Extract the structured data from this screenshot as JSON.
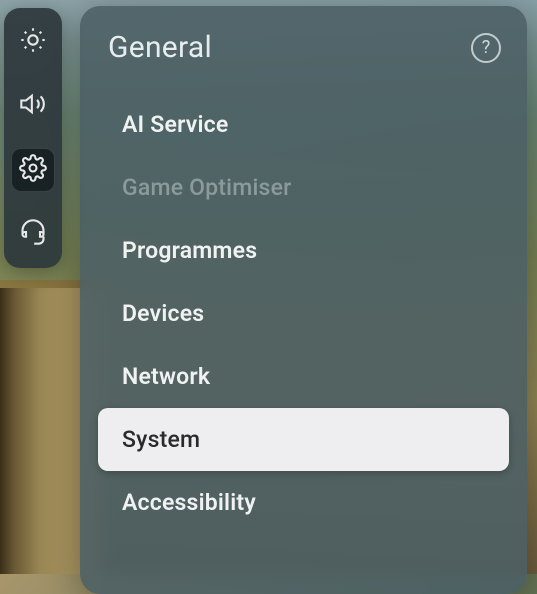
{
  "sidebar": {
    "items": [
      {
        "name": "picture"
      },
      {
        "name": "sound"
      },
      {
        "name": "settings",
        "active": true
      },
      {
        "name": "support"
      }
    ]
  },
  "panel": {
    "title": "General",
    "help": "?"
  },
  "menu": {
    "items": [
      {
        "label": "AI Service",
        "state": "normal"
      },
      {
        "label": "Game Optimiser",
        "state": "disabled"
      },
      {
        "label": "Programmes",
        "state": "normal"
      },
      {
        "label": "Devices",
        "state": "normal"
      },
      {
        "label": "Network",
        "state": "normal"
      },
      {
        "label": "System",
        "state": "selected"
      },
      {
        "label": "Accessibility",
        "state": "normal"
      }
    ]
  }
}
